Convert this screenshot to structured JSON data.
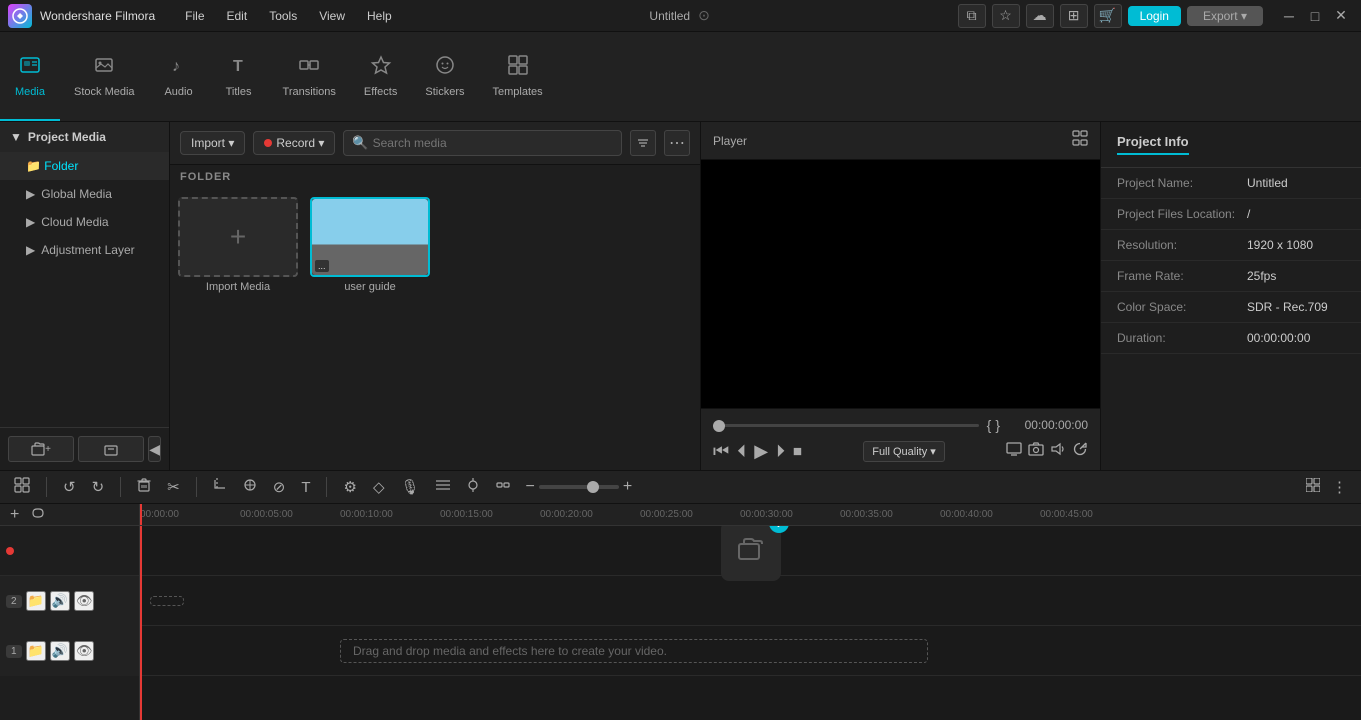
{
  "app": {
    "name": "Wondershare Filmora",
    "title": "Untitled"
  },
  "titlebar": {
    "menu_items": [
      "File",
      "Edit",
      "Tools",
      "View",
      "Help"
    ],
    "title": "Untitled",
    "login_label": "Login",
    "export_label": "Export ▾",
    "minimize": "─",
    "maximize": "□",
    "close": "✕"
  },
  "navbar": {
    "items": [
      {
        "id": "media",
        "icon": "⬛",
        "label": "Media",
        "active": true
      },
      {
        "id": "stock-media",
        "icon": "🎬",
        "label": "Stock Media",
        "active": false
      },
      {
        "id": "audio",
        "icon": "♪",
        "label": "Audio",
        "active": false
      },
      {
        "id": "titles",
        "icon": "T",
        "label": "Titles",
        "active": false
      },
      {
        "id": "transitions",
        "icon": "↔",
        "label": "Transitions",
        "active": false
      },
      {
        "id": "effects",
        "icon": "✦",
        "label": "Effects",
        "active": false
      },
      {
        "id": "stickers",
        "icon": "☺",
        "label": "Stickers",
        "active": false
      },
      {
        "id": "templates",
        "icon": "⊞",
        "label": "Templates",
        "active": false
      }
    ]
  },
  "sidebar": {
    "header": "Project Media",
    "items": [
      {
        "id": "global-media",
        "label": "Global Media"
      },
      {
        "id": "cloud-media",
        "label": "Cloud Media"
      },
      {
        "id": "adjustment-layer",
        "label": "Adjustment Layer"
      }
    ],
    "folder_label": "Folder",
    "add_folder_label": "+",
    "remove_folder_label": "−",
    "collapse_label": "◀"
  },
  "media_panel": {
    "import_label": "Import ▾",
    "record_label": "Record ▾",
    "search_placeholder": "Search media",
    "folder_section": "FOLDER",
    "items": [
      {
        "id": "import",
        "label": "Import Media",
        "is_placeholder": true
      },
      {
        "id": "user-guide",
        "label": "user guide",
        "is_placeholder": false
      }
    ]
  },
  "player": {
    "title": "Player",
    "timecode": "00:00:00:00",
    "quality_label": "Full Quality ▾",
    "transport": {
      "rewind": "⏮",
      "back_frame": "⏴",
      "play": "▶",
      "fwd_frame": "⏵",
      "stop": "⏹"
    }
  },
  "project_info": {
    "tab_label": "Project Info",
    "fields": [
      {
        "label": "Project Name:",
        "value": "Untitled"
      },
      {
        "label": "Project Files Location:",
        "value": "/"
      },
      {
        "label": "Resolution:",
        "value": "1920 x 1080"
      },
      {
        "label": "Frame Rate:",
        "value": "25fps"
      },
      {
        "label": "Color Space:",
        "value": "SDR - Rec.709"
      },
      {
        "label": "Duration:",
        "value": "00:00:00:00"
      }
    ]
  },
  "timeline": {
    "toolbar_buttons": [
      "⊞",
      "↺",
      "↻",
      "🗑",
      "✂",
      "⊕",
      "⊘",
      "T",
      "✎"
    ],
    "timecodes": [
      "00:00:00",
      "00:00:05:00",
      "00:00:10:00",
      "00:00:15:00",
      "00:00:20:00",
      "00:00:25:00",
      "00:00:30:00",
      "00:00:35:00",
      "00:00:40:00",
      "00:00:45:00"
    ],
    "tracks": [
      {
        "number": "2",
        "icons": [
          "📁",
          "🔊",
          "👁"
        ]
      },
      {
        "number": "1",
        "icons": [
          "📁",
          "🔊",
          "👁"
        ]
      }
    ],
    "drag_drop_text": "Drag and drop media and effects here to create your video."
  },
  "icons": {
    "search": "🔍",
    "filter": "⚙",
    "more": "⋯",
    "image": "🖼",
    "settings": "⚙",
    "microphone": "🎙",
    "cut": "✂",
    "undo": "↺",
    "redo": "↻",
    "trash": "🗑",
    "plus": "+",
    "minus": "−",
    "chain": "⛓",
    "marker": "◉",
    "snap": "⊕",
    "zoom_in": "+",
    "zoom_out": "−",
    "grid": "⊞"
  }
}
